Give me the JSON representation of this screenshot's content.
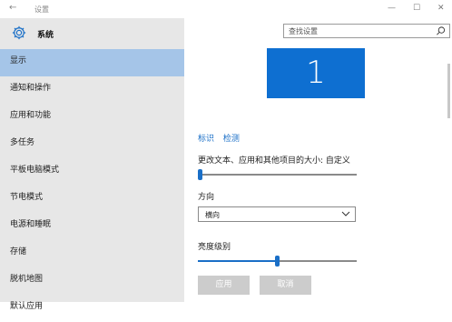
{
  "window": {
    "title": "设置",
    "back": "←",
    "minimize": "—",
    "maximize": "☐",
    "close": "✕"
  },
  "sidebar": {
    "header": "系统",
    "items": [
      {
        "label": "显示",
        "active": true
      },
      {
        "label": "通知和操作"
      },
      {
        "label": "应用和功能"
      },
      {
        "label": "多任务"
      },
      {
        "label": "平板电脑模式"
      },
      {
        "label": "节电模式"
      },
      {
        "label": "电源和睡眠"
      },
      {
        "label": "存储"
      },
      {
        "label": "脱机地图"
      },
      {
        "label": "默认应用"
      }
    ]
  },
  "search": {
    "placeholder": "查找设置"
  },
  "display": {
    "monitor_number": "1",
    "identify": "标识",
    "detect": "检测",
    "scale_label": "更改文本、应用和其他项目的大小: 自定义",
    "scale_value_fraction": 0.0,
    "orientation_label": "方向",
    "orientation_value": "横向",
    "brightness_label": "亮度级别",
    "brightness_fraction": 0.5,
    "apply": "应用",
    "cancel": "取消"
  },
  "colors": {
    "accent": "#1a6fc7",
    "sidebar_bg": "#e7e7e7",
    "active_item": "#a5c5e8",
    "monitor": "#0e6fd1"
  }
}
